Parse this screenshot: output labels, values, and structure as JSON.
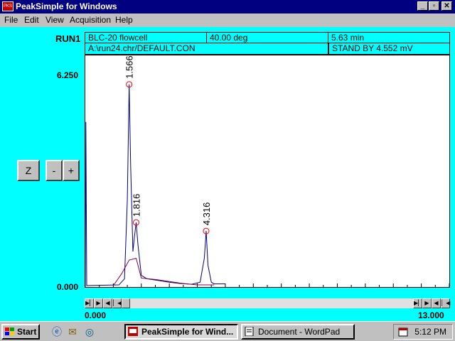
{
  "window": {
    "title": "PeakSimple for Windows",
    "app_icon_text": "PKS"
  },
  "menu": [
    "File",
    "Edit",
    "View",
    "Acquisition",
    "Help"
  ],
  "run": {
    "label": "RUN1",
    "detector": "BLC-20 flowcell",
    "temperature": "40.00 deg",
    "time": "5.63 min",
    "file": "A:\\run24.chr/DEFAULT.CON",
    "status": "STAND BY 4.552 mV"
  },
  "plot": {
    "y_max_label": "6.250",
    "y_min_label": "0.000",
    "x_min_label": "0.000",
    "x_max_label": "13.000",
    "peaks": [
      "1.566",
      "1.816",
      "4.316"
    ]
  },
  "controls": {
    "zoom": "Z",
    "minus": "-",
    "plus": "+"
  },
  "chart_data": {
    "type": "line",
    "xlim": [
      0,
      13
    ],
    "ylim": [
      0,
      6.25
    ],
    "series": [
      {
        "x": [
          0,
          0.02,
          0.05,
          1.2,
          1.4,
          1.5,
          1.566,
          1.62,
          1.7,
          1.75,
          1.816,
          1.88,
          2.0,
          2.2,
          2.6,
          3.0,
          3.4,
          3.8,
          4.1,
          4.25,
          4.316,
          4.38,
          4.5,
          4.6,
          5.0
        ],
        "y": [
          0.0,
          4.8,
          0.0,
          0.02,
          0.2,
          2.5,
          5.9,
          3.5,
          1.0,
          1.4,
          1.85,
          1.2,
          0.3,
          0.2,
          0.15,
          0.1,
          0.06,
          0.04,
          0.1,
          0.8,
          1.6,
          0.6,
          0.1,
          0.05,
          0.05
        ]
      },
      {
        "x": [
          1.0,
          1.3,
          1.566,
          1.816,
          2.0,
          2.5,
          3.0,
          3.5,
          4.0,
          4.316,
          4.6
        ],
        "y": [
          0.0,
          0.35,
          0.75,
          0.8,
          0.22,
          0.18,
          0.12,
          0.06,
          0.02,
          0.02,
          0.02
        ]
      }
    ]
  },
  "taskbar": {
    "start": "Start",
    "tasks": [
      "PeakSimple for Wind...",
      "Document - WordPad"
    ],
    "clock": "5:12 PM"
  },
  "colors": {
    "desktop": "#00ffff",
    "title_bar": "#000080",
    "trace": "#000080",
    "baseline": "#800040",
    "peak_marker": "#ff0000"
  }
}
